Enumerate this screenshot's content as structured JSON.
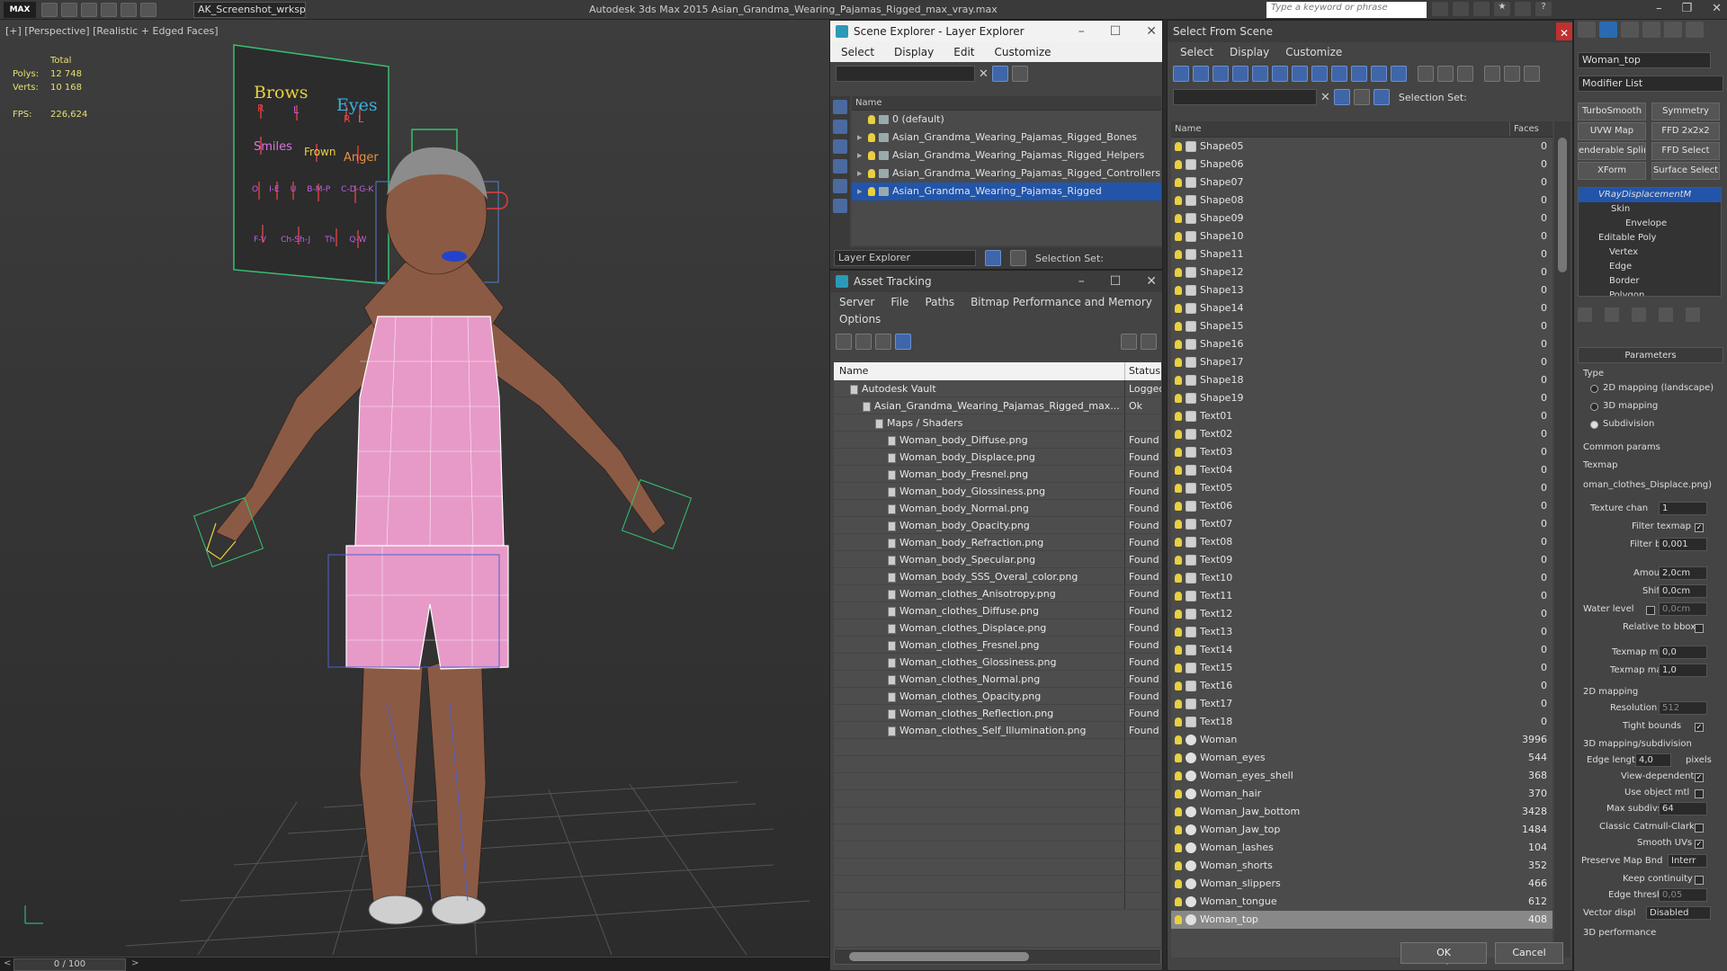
{
  "app": {
    "title": "Autodesk 3ds Max  2015    Asian_Grandma_Wearing_Pajamas_Rigged_max_vray.max",
    "workspace": "AK_Screenshot_wrksp",
    "search_placeholder": "Type a keyword or phrase",
    "logo": "MAX"
  },
  "viewport": {
    "label": "[+] [Perspective] [Realistic + Edged Faces]",
    "stats": {
      "total_label": "Total",
      "polys_label": "Polys:",
      "polys_value": "12 748",
      "verts_label": "Verts:",
      "verts_value": "10 168",
      "fps_label": "FPS:",
      "fps_value": "226,624"
    },
    "face_panel": {
      "brows": "Brows",
      "eyes": "Eyes",
      "r1": "R",
      "l1": "L",
      "r2": "R",
      "l2": "L",
      "smiles": "Smiles",
      "frown": "Frown",
      "anger": "Anger",
      "row3": [
        "O",
        "I-E",
        "U",
        "B-M-P",
        "C-D-G-K"
      ],
      "row4": [
        "F-V",
        "Ch-Sh-J",
        "Th",
        "Q-W"
      ]
    },
    "timeline": "0 / 100"
  },
  "scene_explorer": {
    "title": "Scene Explorer - Layer Explorer",
    "menu": [
      "Select",
      "Display",
      "Edit",
      "Customize"
    ],
    "column": "Name",
    "layers": [
      {
        "name": "0 (default)",
        "selected": false
      },
      {
        "name": "Asian_Grandma_Wearing_Pajamas_Rigged_Bones",
        "selected": false
      },
      {
        "name": "Asian_Grandma_Wearing_Pajamas_Rigged_Helpers",
        "selected": false
      },
      {
        "name": "Asian_Grandma_Wearing_Pajamas_Rigged_Controllers",
        "selected": false
      },
      {
        "name": "Asian_Grandma_Wearing_Pajamas_Rigged",
        "selected": true
      }
    ],
    "footer_label": "Layer Explorer",
    "selection_set": "Selection Set:"
  },
  "asset_tracking": {
    "title": "Asset Tracking",
    "menu": [
      "Server",
      "File",
      "Paths",
      "Bitmap Performance and Memory"
    ],
    "menu2": "Options",
    "columns": [
      "Name",
      "Status"
    ],
    "rows": [
      {
        "name": "Autodesk Vault",
        "status": "Logged",
        "indent": 1
      },
      {
        "name": "Asian_Grandma_Wearing_Pajamas_Rigged_max...",
        "status": "Ok",
        "indent": 2
      },
      {
        "name": "Maps / Shaders",
        "status": "",
        "indent": 3
      },
      {
        "name": "Woman_body_Diffuse.png",
        "status": "Found",
        "indent": 4
      },
      {
        "name": "Woman_body_Displace.png",
        "status": "Found",
        "indent": 4
      },
      {
        "name": "Woman_body_Fresnel.png",
        "status": "Found",
        "indent": 4
      },
      {
        "name": "Woman_body_Glossiness.png",
        "status": "Found",
        "indent": 4
      },
      {
        "name": "Woman_body_Normal.png",
        "status": "Found",
        "indent": 4
      },
      {
        "name": "Woman_body_Opacity.png",
        "status": "Found",
        "indent": 4
      },
      {
        "name": "Woman_body_Refraction.png",
        "status": "Found",
        "indent": 4
      },
      {
        "name": "Woman_body_Specular.png",
        "status": "Found",
        "indent": 4
      },
      {
        "name": "Woman_body_SSS_Overal_color.png",
        "status": "Found",
        "indent": 4
      },
      {
        "name": "Woman_clothes_Anisotropy.png",
        "status": "Found",
        "indent": 4
      },
      {
        "name": "Woman_clothes_Diffuse.png",
        "status": "Found",
        "indent": 4
      },
      {
        "name": "Woman_clothes_Displace.png",
        "status": "Found",
        "indent": 4
      },
      {
        "name": "Woman_clothes_Fresnel.png",
        "status": "Found",
        "indent": 4
      },
      {
        "name": "Woman_clothes_Glossiness.png",
        "status": "Found",
        "indent": 4
      },
      {
        "name": "Woman_clothes_Normal.png",
        "status": "Found",
        "indent": 4
      },
      {
        "name": "Woman_clothes_Opacity.png",
        "status": "Found",
        "indent": 4
      },
      {
        "name": "Woman_clothes_Reflection.png",
        "status": "Found",
        "indent": 4
      },
      {
        "name": "Woman_clothes_Self_Illumination.png",
        "status": "Found",
        "indent": 4
      }
    ]
  },
  "select_from_scene": {
    "title": "Select From Scene",
    "menu": [
      "Select",
      "Display",
      "Customize"
    ],
    "selection_set": "Selection Set:",
    "columns": [
      "Name",
      "Faces"
    ],
    "objects": [
      {
        "name": "Shape05",
        "faces": "0",
        "kind": "shape"
      },
      {
        "name": "Shape06",
        "faces": "0",
        "kind": "shape"
      },
      {
        "name": "Shape07",
        "faces": "0",
        "kind": "shape"
      },
      {
        "name": "Shape08",
        "faces": "0",
        "kind": "shape"
      },
      {
        "name": "Shape09",
        "faces": "0",
        "kind": "shape"
      },
      {
        "name": "Shape10",
        "faces": "0",
        "kind": "shape"
      },
      {
        "name": "Shape11",
        "faces": "0",
        "kind": "shape"
      },
      {
        "name": "Shape12",
        "faces": "0",
        "kind": "shape"
      },
      {
        "name": "Shape13",
        "faces": "0",
        "kind": "shape"
      },
      {
        "name": "Shape14",
        "faces": "0",
        "kind": "shape"
      },
      {
        "name": "Shape15",
        "faces": "0",
        "kind": "shape"
      },
      {
        "name": "Shape16",
        "faces": "0",
        "kind": "shape"
      },
      {
        "name": "Shape17",
        "faces": "0",
        "kind": "shape"
      },
      {
        "name": "Shape18",
        "faces": "0",
        "kind": "shape"
      },
      {
        "name": "Shape19",
        "faces": "0",
        "kind": "shape"
      },
      {
        "name": "Text01",
        "faces": "0",
        "kind": "shape"
      },
      {
        "name": "Text02",
        "faces": "0",
        "kind": "shape"
      },
      {
        "name": "Text03",
        "faces": "0",
        "kind": "shape"
      },
      {
        "name": "Text04",
        "faces": "0",
        "kind": "shape"
      },
      {
        "name": "Text05",
        "faces": "0",
        "kind": "shape"
      },
      {
        "name": "Text06",
        "faces": "0",
        "kind": "shape"
      },
      {
        "name": "Text07",
        "faces": "0",
        "kind": "shape"
      },
      {
        "name": "Text08",
        "faces": "0",
        "kind": "shape"
      },
      {
        "name": "Text09",
        "faces": "0",
        "kind": "shape"
      },
      {
        "name": "Text10",
        "faces": "0",
        "kind": "shape"
      },
      {
        "name": "Text11",
        "faces": "0",
        "kind": "shape"
      },
      {
        "name": "Text12",
        "faces": "0",
        "kind": "shape"
      },
      {
        "name": "Text13",
        "faces": "0",
        "kind": "shape"
      },
      {
        "name": "Text14",
        "faces": "0",
        "kind": "shape"
      },
      {
        "name": "Text15",
        "faces": "0",
        "kind": "shape"
      },
      {
        "name": "Text16",
        "faces": "0",
        "kind": "shape"
      },
      {
        "name": "Text17",
        "faces": "0",
        "kind": "shape"
      },
      {
        "name": "Text18",
        "faces": "0",
        "kind": "shape"
      },
      {
        "name": "Woman",
        "faces": "3996",
        "kind": "mesh"
      },
      {
        "name": "Woman_eyes",
        "faces": "544",
        "kind": "mesh"
      },
      {
        "name": "Woman_eyes_shell",
        "faces": "368",
        "kind": "mesh"
      },
      {
        "name": "Woman_hair",
        "faces": "370",
        "kind": "mesh"
      },
      {
        "name": "Woman_Jaw_bottom",
        "faces": "3428",
        "kind": "mesh"
      },
      {
        "name": "Woman_Jaw_top",
        "faces": "1484",
        "kind": "mesh"
      },
      {
        "name": "Woman_lashes",
        "faces": "104",
        "kind": "mesh"
      },
      {
        "name": "Woman_shorts",
        "faces": "352",
        "kind": "mesh"
      },
      {
        "name": "Woman_slippers",
        "faces": "466",
        "kind": "mesh"
      },
      {
        "name": "Woman_tongue",
        "faces": "612",
        "kind": "mesh"
      },
      {
        "name": "Woman_top",
        "faces": "408",
        "kind": "mesh",
        "selected": true
      }
    ],
    "ok": "OK",
    "cancel": "Cancel"
  },
  "command_panel": {
    "object_name": "Woman_top",
    "modifier_list": "Modifier List",
    "buttons": [
      "TurboSmooth",
      "Symmetry",
      "UVW Map",
      "FFD 2x2x2",
      "enderable Splin",
      "FFD Select",
      "XForm",
      "Surface Select"
    ],
    "stack": [
      "VRayDisplacementM",
      "Skin",
      "Envelope",
      "Editable Poly",
      "Vertex",
      "Edge",
      "Border",
      "Polygon"
    ],
    "params": {
      "title": "Parameters",
      "type": "Type",
      "map2d": "2D mapping (landscape)",
      "map3d": "3D mapping",
      "subdiv": "Subdivision",
      "common": "Common params",
      "texmap": "Texmap",
      "texmap_val": "oman_clothes_Displace.png)",
      "texture_chan": "Texture chan",
      "texture_chan_val": "1",
      "filter_texmap": "Filter texmap",
      "filter_blur": "Filter blur",
      "filter_blur_val": "0,001",
      "amount": "Amount",
      "amount_val": "2,0cm",
      "shift": "Shift",
      "shift_val": "0,0cm",
      "water": "Water level",
      "water_val": "0,0cm",
      "relative": "Relative to bbox",
      "texmap_min": "Texmap min",
      "texmap_min_val": "0,0",
      "texmap_max": "Texmap max",
      "texmap_max_val": "1,0",
      "map2d_title": "2D mapping",
      "resolution": "Resolution",
      "resolution_val": "512",
      "tight": "Tight bounds",
      "map3d_title": "3D mapping/subdivision",
      "edge_length": "Edge length",
      "edge_length_val": "4,0",
      "pixels": "pixels",
      "view_dep": "View-dependent",
      "use_obj": "Use object mtl",
      "max_subdivs": "Max subdivs",
      "max_subdivs_val": "64",
      "catmull": "Classic Catmull-Clark",
      "smooth_uvs": "Smooth UVs",
      "preserve": "Preserve Map Bnd",
      "preserve_val": "Interr",
      "keep": "Keep continuity",
      "edge_thresh": "Edge thresh",
      "edge_thresh_val": "0,05",
      "vector": "Vector displ",
      "vector_val": "Disabled",
      "perf": "3D performance"
    }
  },
  "colors": {
    "selection_blue": "#2255aa",
    "pajama_pink": "#e79ac8",
    "skin": "#8a5a44",
    "wire_green": "#38c070"
  }
}
